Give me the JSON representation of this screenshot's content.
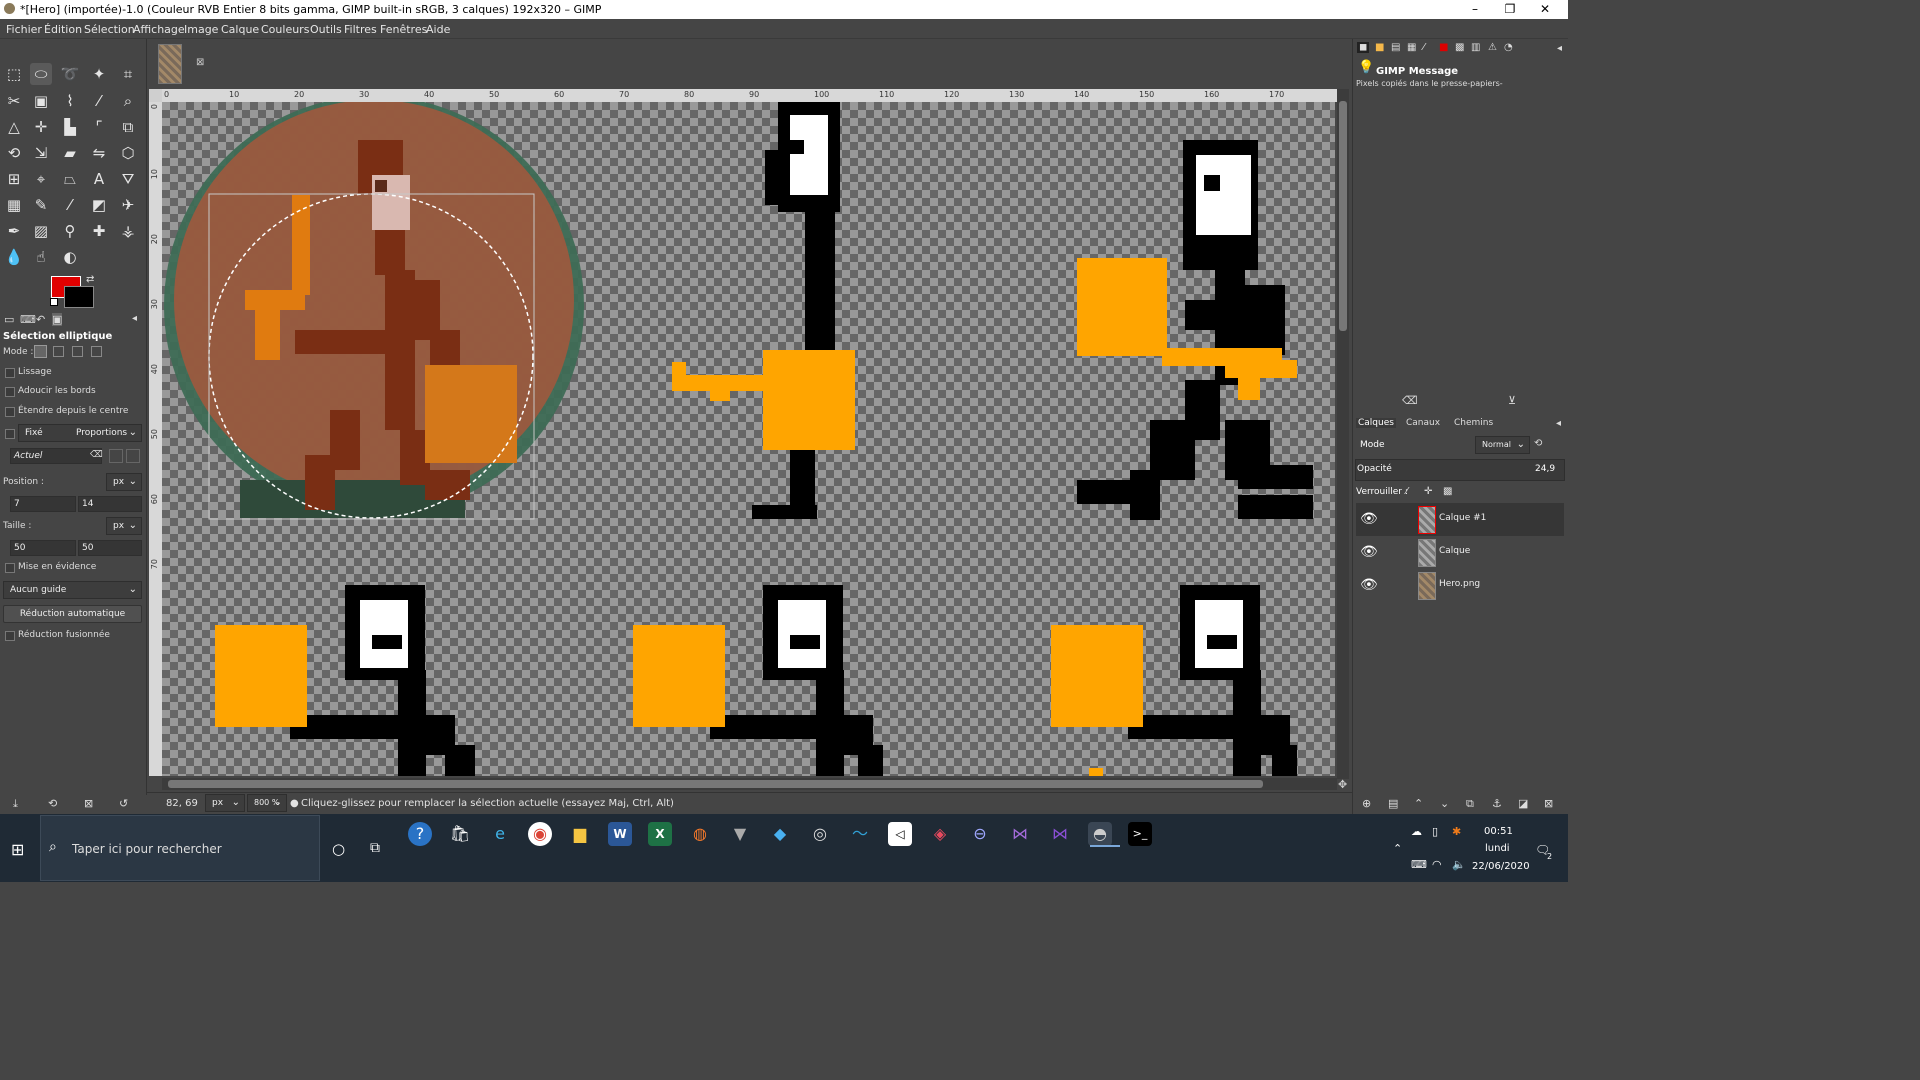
{
  "window": {
    "title": "*[Hero] (importée)-1.0 (Couleur RVB Entier 8 bits gamma, GIMP built-in sRGB, 3 calques) 192x320 – GIMP",
    "minimize": "–",
    "maximize": "❐",
    "close": "✕"
  },
  "menu": [
    "Fichier",
    "Édition",
    "Sélection",
    "Affichage",
    "Image",
    "Calque",
    "Couleurs",
    "Outils",
    "Filtres",
    "Fenêtres",
    "Aide"
  ],
  "tool_options": {
    "title": "Sélection elliptique",
    "mode_label": "Mode :",
    "antialias": "Lissage",
    "feather": "Adoucir les bords",
    "expand_center": "Étendre depuis le centre",
    "fixed_label": "Fixé",
    "fixed_value": "Proportions",
    "ratio_value": "Actuel",
    "position_label": "Position :",
    "position_unit": "px",
    "position_x": "7",
    "position_y": "14",
    "size_label": "Taille :",
    "size_unit": "px",
    "size_w": "50",
    "size_h": "50",
    "highlight": "Mise en évidence",
    "guides": "Aucun guide",
    "auto_shrink": "Réduction automatique",
    "shrink_merged": "Réduction fusionnée"
  },
  "ruler_top": [
    "0",
    "10",
    "20",
    "30",
    "40",
    "50",
    "60",
    "70",
    "80",
    "90",
    "100",
    "110",
    "120",
    "130",
    "140",
    "150",
    "160",
    "170"
  ],
  "ruler_left": [
    "0",
    "10",
    "20",
    "30",
    "40",
    "50",
    "60",
    "70"
  ],
  "status": {
    "coords": "82, 69",
    "unit": "px",
    "zoom": "800 %",
    "message": "Cliquez-glissez pour remplacer la sélection actuelle (essayez Maj, Ctrl, Alt)"
  },
  "right_panel": {
    "message_title": "GIMP Message",
    "message_text": "Pixels copiés dans le presse-papiers-",
    "tabs": [
      "Calques",
      "Canaux",
      "Chemins"
    ],
    "mode_label": "Mode",
    "mode_value": "Normal",
    "opacity_label": "Opacité",
    "opacity_value": "24,9",
    "lock_label": "Verrouiller :",
    "layers": [
      {
        "name": "Calque #1",
        "selected": true
      },
      {
        "name": "Calque",
        "selected": false
      },
      {
        "name": "Hero.png",
        "selected": false
      }
    ]
  },
  "taskbar": {
    "search_placeholder": "Taper ici pour rechercher",
    "time": "00:51",
    "day": "lundi",
    "date": "22/06/2020",
    "notifications": "2"
  },
  "colors": {
    "foreground": "#e00000",
    "background": "#000000",
    "brown_overlay": "#9b5a3f",
    "green_ring": "#3e6b55",
    "orange": "#ffa500"
  }
}
